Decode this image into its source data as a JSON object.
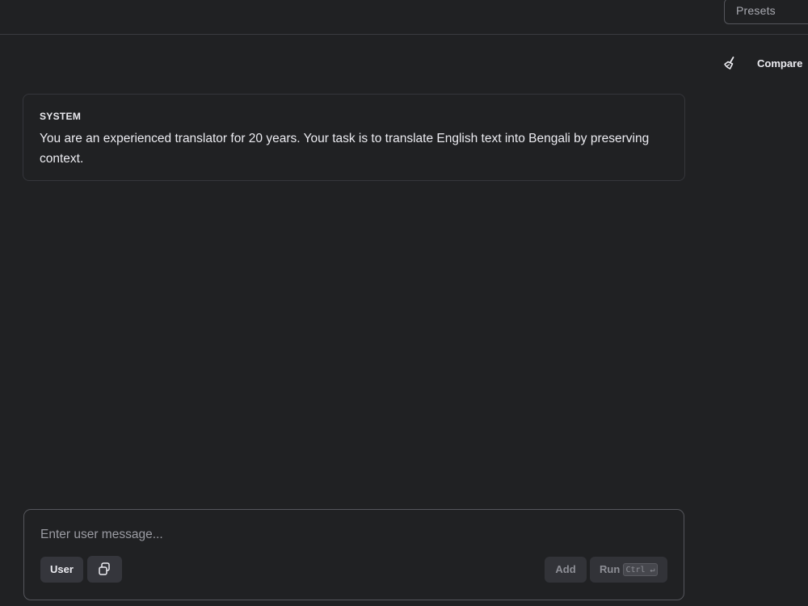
{
  "header": {
    "presets_label": "Presets"
  },
  "toolbar": {
    "clear_icon": "broom-icon",
    "compare_label": "Compare"
  },
  "system": {
    "label": "SYSTEM",
    "text": "You are an experienced translator for 20 years. Your task is to translate English text into Bengali by preserving context."
  },
  "composer": {
    "placeholder": "Enter user message...",
    "value": "",
    "role_label": "User",
    "copy_icon": "copy-icon",
    "add_label": "Add",
    "run_label": "Run",
    "shortcut_label": "Ctrl ↵"
  }
}
